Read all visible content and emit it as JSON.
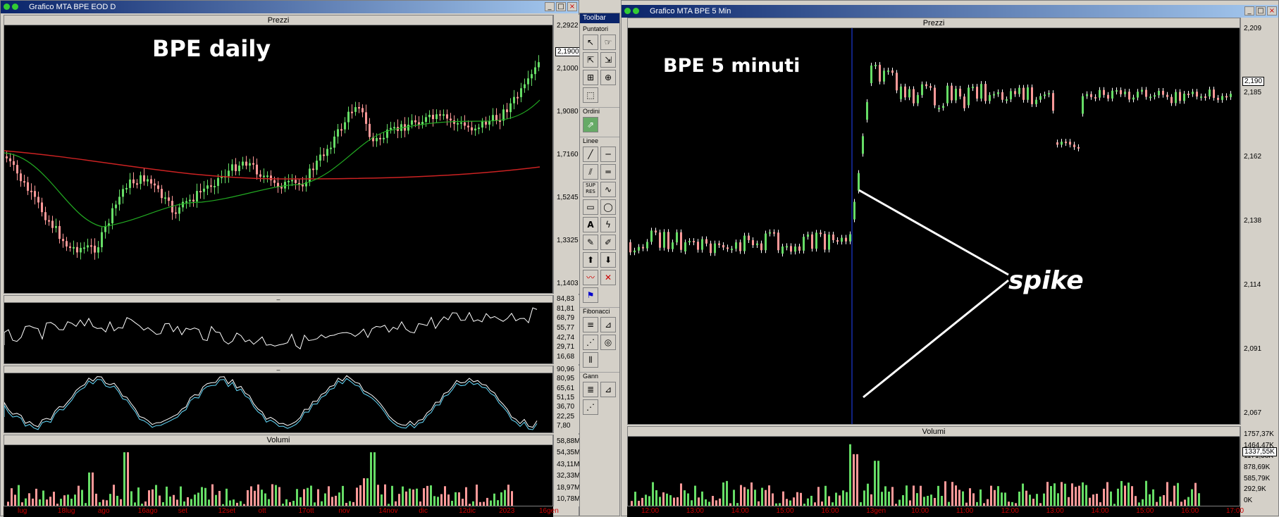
{
  "left_window": {
    "title": "Grafico MTA BPE EOD D",
    "overlay": "BPE daily",
    "price_panel": {
      "title": "Prezzi",
      "yticks": [
        "2,2922",
        "2,1000",
        "1,9080",
        "1,7160",
        "1,5245",
        "1,3325",
        "1,1403"
      ],
      "highlight": "2,1900"
    },
    "osc1": {
      "title": "–",
      "yticks": [
        "84,83",
        "81,81",
        "68,79",
        "55,77",
        "42,74",
        "29,71",
        "16,68"
      ]
    },
    "osc2": {
      "title": "–",
      "yticks": [
        "90,96",
        "80,95",
        "65,61",
        "51,15",
        "36,70",
        "22,25",
        "7,80"
      ]
    },
    "vol": {
      "title": "Volumi",
      "yticks": [
        "58,88M",
        "54,35M",
        "43,11M",
        "32,33M",
        "18,97M",
        "10,78M"
      ]
    },
    "xticks": [
      "lug",
      "18lug",
      "ago",
      "16ago",
      "set",
      "12set",
      "ott",
      "17ott",
      "nov",
      "14nov",
      "dic",
      "12dic",
      "2023",
      "16gen"
    ]
  },
  "right_window": {
    "title": "Grafico MTA BPE 5 Min",
    "overlay": "BPE 5 minuti",
    "annotation": "spike",
    "price_panel": {
      "title": "Prezzi",
      "yticks": [
        "2,209",
        "2,185",
        "2,162",
        "2,138",
        "2,114",
        "2,091",
        "2,067"
      ],
      "highlight": "2,190"
    },
    "vol": {
      "title": "Volumi",
      "yticks": [
        "1757,37K",
        "1464,47K",
        "1171,58K",
        "878,69K",
        "585,79K",
        "292,9K",
        "0K"
      ],
      "highlight": "1337,55K"
    },
    "xticks": [
      "12:00",
      "13:00",
      "14:00",
      "15:00",
      "16:00",
      "13gen",
      "10:00",
      "11:00",
      "12:00",
      "13:00",
      "14:00",
      "15:00",
      "16:00",
      "17:00"
    ]
  },
  "toolbar": {
    "title": "Toolbar",
    "sections": [
      "Puntatori",
      "Ordini",
      "Linee",
      "Fibonacci",
      "Gann"
    ]
  },
  "colors": {
    "up": "#66dd66",
    "down": "#ff9999",
    "sma_long": "#cc2222",
    "sma_short": "#22aa22",
    "osc": "#ffffff",
    "stoch_d": "#66ddff"
  }
}
